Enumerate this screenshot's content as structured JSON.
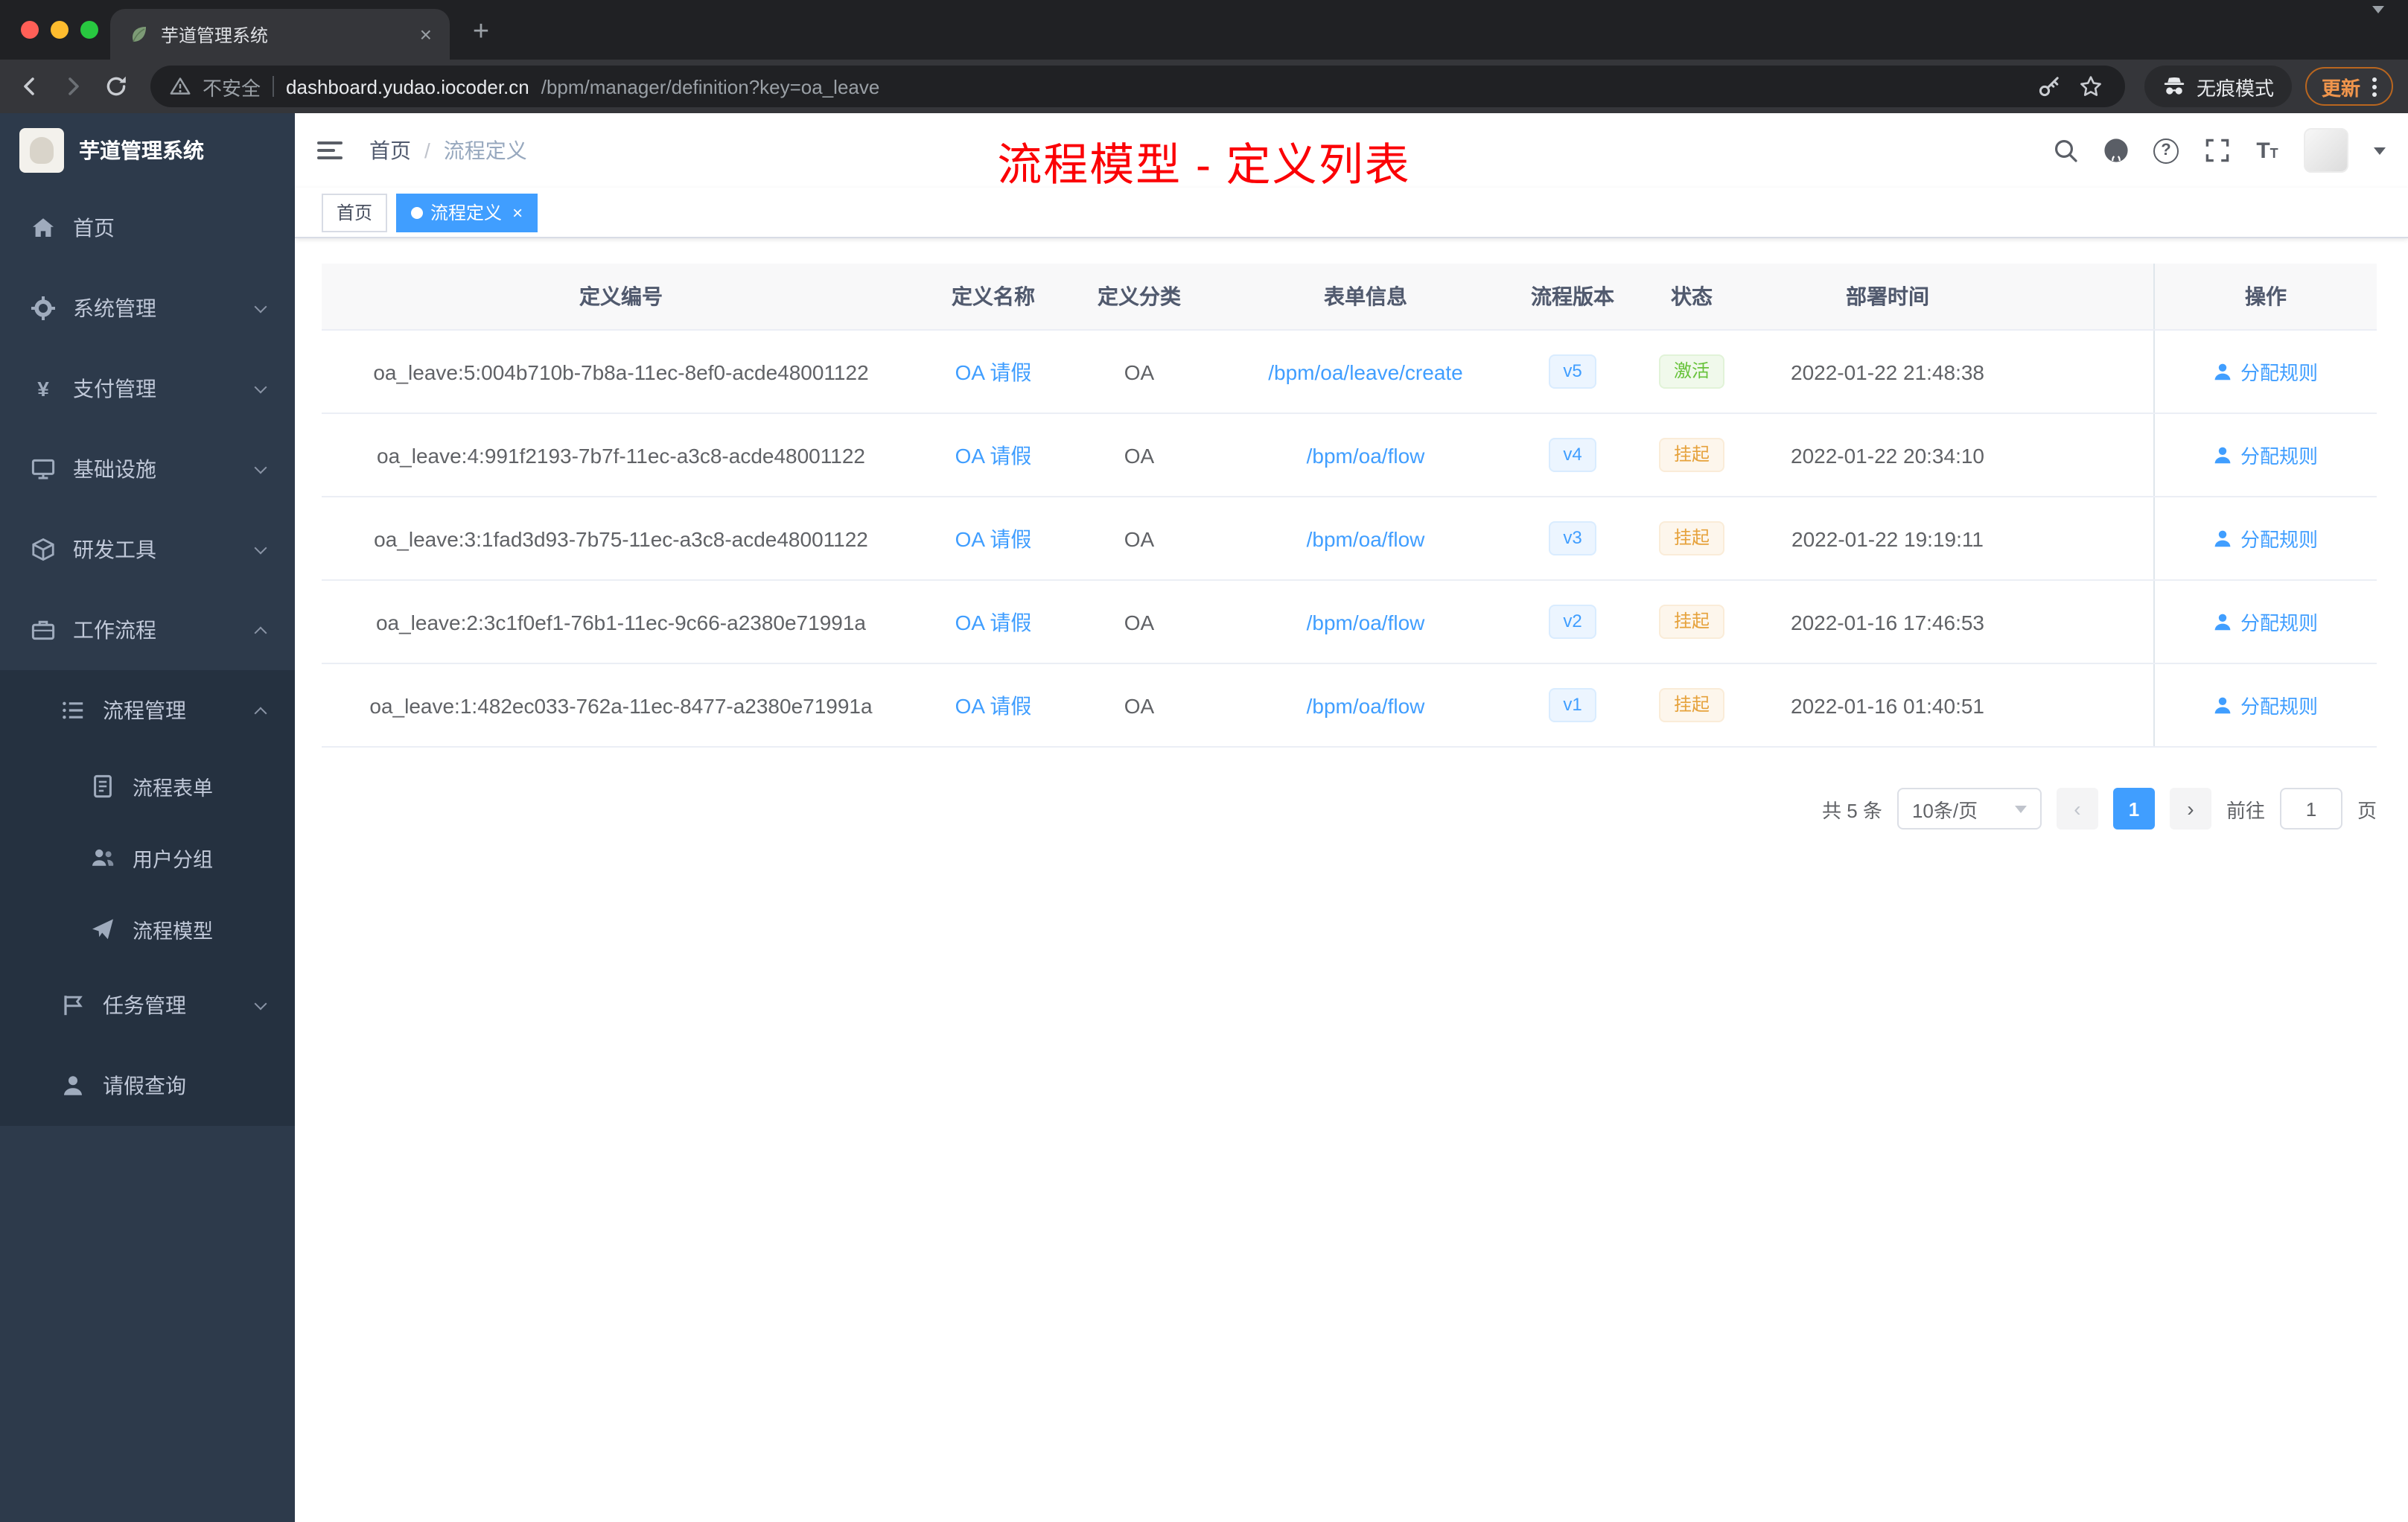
{
  "colors": {
    "accent": "#409eff",
    "status_active": "#67c23a",
    "status_suspended": "#e6a23c",
    "annotation_red": "#fb0005",
    "sidebar_bg": "#2d3a4b",
    "browser_dark": "#202124"
  },
  "browser": {
    "tab_title": "芋道管理系统",
    "security_label": "不安全",
    "url_host": "dashboard.yudao.iocoder.cn",
    "url_path": "/bpm/manager/definition?key=oa_leave",
    "incognito_label": "无痕模式",
    "update_label": "更新"
  },
  "sidebar": {
    "logo_title": "芋道管理系统",
    "items": [
      {
        "label": "首页"
      },
      {
        "label": "系统管理"
      },
      {
        "label": "支付管理"
      },
      {
        "label": "基础设施"
      },
      {
        "label": "研发工具"
      },
      {
        "label": "工作流程"
      },
      {
        "label": "流程管理"
      },
      {
        "label": "流程表单"
      },
      {
        "label": "用户分组"
      },
      {
        "label": "流程模型"
      },
      {
        "label": "任务管理"
      },
      {
        "label": "请假查询"
      }
    ]
  },
  "header": {
    "breadcrumb_home": "首页",
    "breadcrumb_separator": "/",
    "breadcrumb_current": "流程定义",
    "annotation": "流程模型 - 定义列表"
  },
  "tags_bar": {
    "tag_home": "首页",
    "tag_active": "流程定义"
  },
  "table": {
    "columns": [
      "定义编号",
      "定义名称",
      "定义分类",
      "表单信息",
      "流程版本",
      "状态",
      "部署时间",
      "操作"
    ],
    "rows": [
      {
        "id": "oa_leave:5:004b710b-7b8a-11ec-8ef0-acde48001122",
        "name": "OA 请假",
        "category": "OA",
        "form": "/bpm/oa/leave/create",
        "version": "v5",
        "status": "激活",
        "deploy_time": "2022-01-22 21:48:38",
        "action": "分配规则"
      },
      {
        "id": "oa_leave:4:991f2193-7b7f-11ec-a3c8-acde48001122",
        "name": "OA 请假",
        "category": "OA",
        "form": "/bpm/oa/flow",
        "version": "v4",
        "status": "挂起",
        "deploy_time": "2022-01-22 20:34:10",
        "action": "分配规则"
      },
      {
        "id": "oa_leave:3:1fad3d93-7b75-11ec-a3c8-acde48001122",
        "name": "OA 请假",
        "category": "OA",
        "form": "/bpm/oa/flow",
        "version": "v3",
        "status": "挂起",
        "deploy_time": "2022-01-22 19:19:11",
        "action": "分配规则"
      },
      {
        "id": "oa_leave:2:3c1f0ef1-76b1-11ec-9c66-a2380e71991a",
        "name": "OA 请假",
        "category": "OA",
        "form": "/bpm/oa/flow",
        "version": "v2",
        "status": "挂起",
        "deploy_time": "2022-01-16 17:46:53",
        "action": "分配规则"
      },
      {
        "id": "oa_leave:1:482ec033-762a-11ec-8477-a2380e71991a",
        "name": "OA 请假",
        "category": "OA",
        "form": "/bpm/oa/flow",
        "version": "v1",
        "status": "挂起",
        "deploy_time": "2022-01-16 01:40:51",
        "action": "分配规则"
      }
    ]
  },
  "pagination": {
    "total": "共 5 条",
    "page_size": "10条/页",
    "current_page": "1",
    "goto_label": "前往",
    "goto_value": "1",
    "goto_unit": "页"
  }
}
